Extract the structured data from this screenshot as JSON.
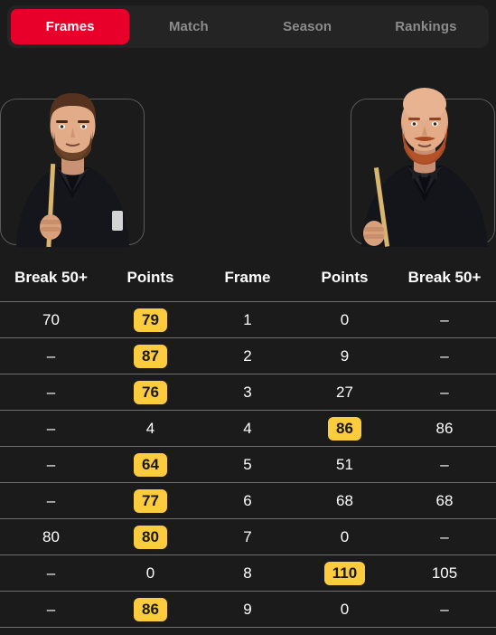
{
  "tabs": [
    {
      "label": "Frames",
      "active": true
    },
    {
      "label": "Match",
      "active": false
    },
    {
      "label": "Season",
      "active": false
    },
    {
      "label": "Rankings",
      "active": false
    }
  ],
  "players": {
    "left": {
      "photo": "snooker-player-photo-left",
      "description": "snooker player with short dark hair, beard and cue, dark shirt"
    },
    "right": {
      "photo": "snooker-player-photo-right",
      "description": "bald snooker player with red beard, bow tie and cue, dark shirt"
    }
  },
  "table": {
    "headers": [
      "Break 50+",
      "Points",
      "Frame",
      "Points",
      "Break 50+"
    ],
    "rows": [
      {
        "break_left": "70",
        "points_left": "79",
        "points_left_winner": true,
        "frame": "1",
        "points_right": "0",
        "points_right_winner": false,
        "break_right": "–"
      },
      {
        "break_left": "–",
        "points_left": "87",
        "points_left_winner": true,
        "frame": "2",
        "points_right": "9",
        "points_right_winner": false,
        "break_right": "–"
      },
      {
        "break_left": "–",
        "points_left": "76",
        "points_left_winner": true,
        "frame": "3",
        "points_right": "27",
        "points_right_winner": false,
        "break_right": "–"
      },
      {
        "break_left": "–",
        "points_left": "4",
        "points_left_winner": false,
        "frame": "4",
        "points_right": "86",
        "points_right_winner": true,
        "break_right": "86"
      },
      {
        "break_left": "–",
        "points_left": "64",
        "points_left_winner": true,
        "frame": "5",
        "points_right": "51",
        "points_right_winner": false,
        "break_right": "–"
      },
      {
        "break_left": "–",
        "points_left": "77",
        "points_left_winner": true,
        "frame": "6",
        "points_right": "68",
        "points_right_winner": false,
        "break_right": "68"
      },
      {
        "break_left": "80",
        "points_left": "80",
        "points_left_winner": true,
        "frame": "7",
        "points_right": "0",
        "points_right_winner": false,
        "break_right": "–"
      },
      {
        "break_left": "–",
        "points_left": "0",
        "points_left_winner": false,
        "frame": "8",
        "points_right": "110",
        "points_right_winner": true,
        "break_right": "105"
      },
      {
        "break_left": "–",
        "points_left": "86",
        "points_left_winner": true,
        "frame": "9",
        "points_right": "0",
        "points_right_winner": false,
        "break_right": "–"
      }
    ]
  },
  "colors": {
    "background": "#1b1b1b",
    "tabbar": "#242424",
    "accent_red": "#e8002b",
    "badge_yellow": "#fccb3e",
    "divider": "#6e6e6e",
    "inactive_tab_text": "#8c8c8c"
  }
}
